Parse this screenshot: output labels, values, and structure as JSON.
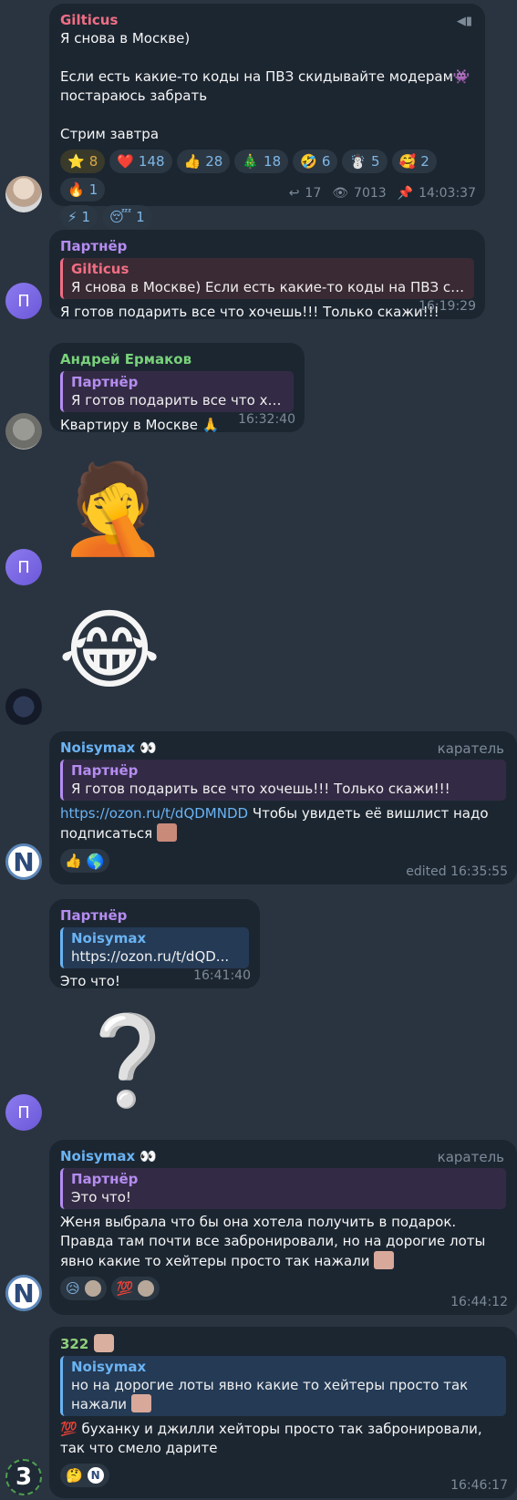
{
  "colors": {
    "bg": "#2a3440",
    "bubble": "#1c2631",
    "gilticus": "#f06e84",
    "partner": "#b58cf0",
    "andrey": "#78d27a",
    "noisymax": "#6ab3f3",
    "user322": "#8fd07a"
  },
  "messages": [
    {
      "sender": "Gilticus",
      "lines": [
        "Я снова в Москве)",
        "",
        "Если есть какие-то коды на ПВЗ скидывайте модерам👾",
        "постараюсь забрать",
        "",
        "Стрим завтра"
      ],
      "reactions_row1": [
        {
          "emoji": "⭐",
          "count": "8"
        },
        {
          "emoji": "❤️",
          "count": "148"
        },
        {
          "emoji": "👍",
          "count": "28"
        },
        {
          "emoji": "🎄",
          "count": "18"
        },
        {
          "emoji": "🤣",
          "count": "6"
        },
        {
          "emoji": "☃️",
          "count": "5"
        },
        {
          "emoji": "🥰",
          "count": "2"
        },
        {
          "emoji": "🔥",
          "count": "1"
        }
      ],
      "reactions_row2": [
        {
          "emoji": "⚡",
          "count": "1"
        },
        {
          "emoji": "😴",
          "count": "1"
        }
      ],
      "forwards": "17",
      "views": "7013",
      "time": "14:03:37"
    },
    {
      "sender": "Партнёр",
      "reply_name": "Gilticus",
      "reply_text": "Я снова в Москве)  Если есть какие-то коды на ПВЗ скид...",
      "text": "Я готов подарить все что хочешь!!! Только скажи!!!",
      "time": "16:19:29"
    },
    {
      "sender": "Андрей Ермаков",
      "reply_name": "Партнёр",
      "reply_text": "Я готов подарить все что хо...",
      "text": "Квартиру в Москве 🙏",
      "time": "16:32:40"
    },
    {
      "sticker": "🤦"
    },
    {
      "sticker": "😂"
    },
    {
      "sender": "Noisymax 👀",
      "tag": "каратель",
      "reply_name": "Партнёр",
      "reply_text": "Я готов подарить все что хочешь!!! Только скажи!!!",
      "link": "https://ozon.ru/t/dQDMNDD",
      "text_after_link": " Чтобы увидеть её вишлист надо",
      "text_line2": "подписаться",
      "reactions": [
        {
          "emoji": "👍",
          "count": ""
        },
        {
          "emoji": "🌎",
          "count": ""
        }
      ],
      "time": "edited 16:35:55"
    },
    {
      "sender": "Партнёр",
      "reply_name": "Noisymax",
      "reply_text": "https://ozon.ru/t/dQD...",
      "text": "Это что!",
      "time": "16:41:40"
    },
    {
      "sticker": "❔"
    },
    {
      "sender": "Noisymax 👀",
      "tag": "каратель",
      "reply_name": "Партнёр",
      "reply_text": "Это что!",
      "lines": [
        "Женя выбрала что бы она хотела получить в подарок.",
        "Правда там почти все забронировали, но на дорогие лоты",
        "явно какие то хейтеры просто так нажали"
      ],
      "reactions": [
        {
          "emoji": "😥",
          "count": ""
        },
        {
          "emoji": "💯",
          "count": ""
        }
      ],
      "time": "16:44:12"
    },
    {
      "sender": "322",
      "reply_name": "Noisymax",
      "reply_text_1": "но на дорогие лоты явно какие то хейтеры просто так",
      "reply_text_2": "нажали",
      "lines": [
        "💯 буханку и джилли хейторы просто так забронировали,",
        "так что смело дарите"
      ],
      "reactions": [
        {
          "emoji": "🤔",
          "count": ""
        }
      ],
      "time": "16:46:17"
    }
  ]
}
